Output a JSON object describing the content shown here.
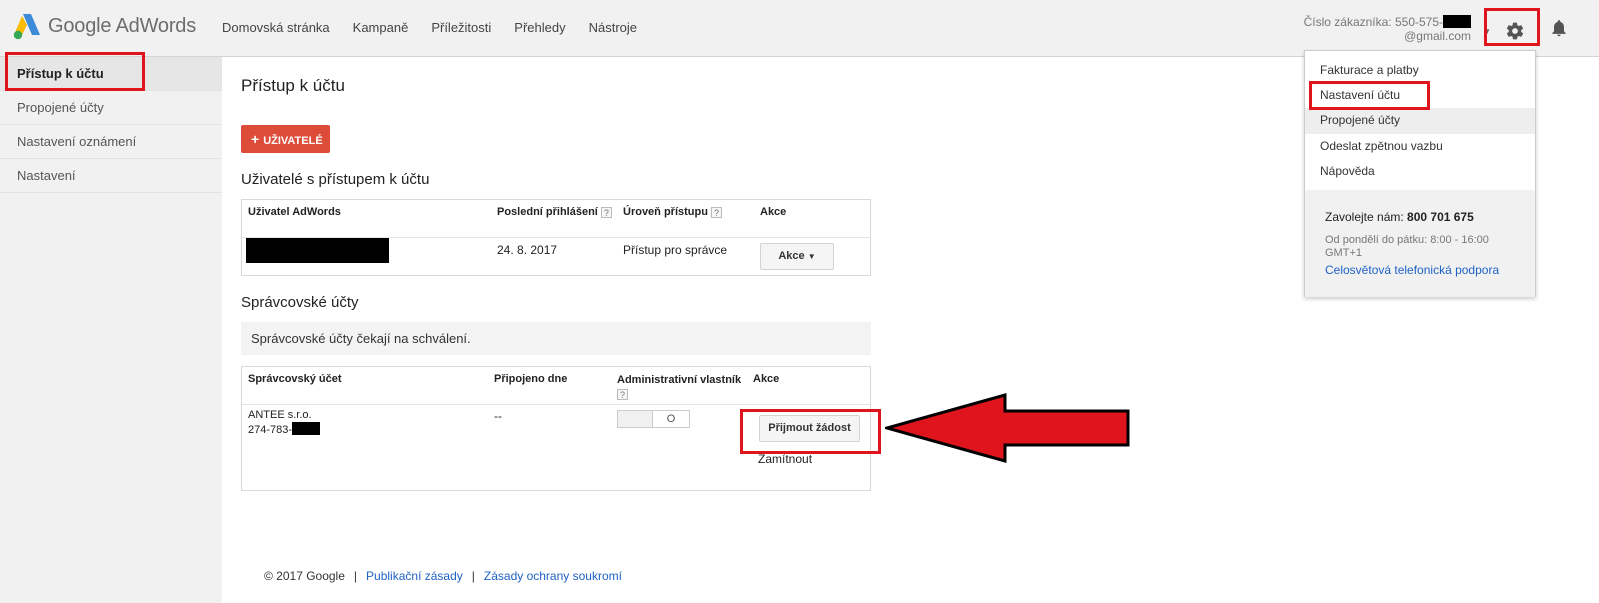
{
  "header": {
    "logo_text": "Google AdWords",
    "nav": [
      "Domovská stránka",
      "Kampaně",
      "Příležitosti",
      "Přehledy",
      "Nástroje"
    ],
    "customer_label": "Číslo zákazníka: 550-575-",
    "customer_email": "@gmail.com"
  },
  "sidebar": {
    "items": [
      {
        "label": "Přístup k účtu"
      },
      {
        "label": "Propojené účty"
      },
      {
        "label": "Nastavení oznámení"
      },
      {
        "label": "Nastavení"
      }
    ]
  },
  "main": {
    "title": "Přístup k účtu",
    "add_button": "UŽIVATELÉ",
    "users_section": "Uživatelé s přístupem k účtu",
    "users_table": {
      "headers": [
        "Uživatel AdWords",
        "Poslední přihlášení",
        "Úroveň přístupu",
        "Akce"
      ],
      "row": {
        "last_login": "24. 8. 2017",
        "access_level": "Přístup pro správce",
        "action": "Akce"
      }
    },
    "managers_section": "Správcovské účty",
    "pending_note": "Správcovské účty čekají na schválení.",
    "managers_table": {
      "headers": [
        "Správcovský účet",
        "Připojeno dne",
        "Administrativní vlastník",
        "Akce"
      ],
      "row": {
        "name": "ANTEE s.r.o.",
        "id": "274-783-",
        "connected": "--",
        "toggle_state": "O",
        "accept": "Přijmout žádost",
        "reject": "Zamítnout"
      }
    }
  },
  "dropdown": {
    "items": [
      "Fakturace a platby",
      "Nastavení účtu",
      "Propojené účty",
      "Odeslat zpětnou vazbu",
      "Nápověda"
    ],
    "call_label": "Zavolejte nám:",
    "call_number": "800 701 675",
    "hours": "Od pondělí do pátku: 8:00 - 16:00 GMT+1",
    "support_link": "Celosvětová telefonická podpora"
  },
  "footer": {
    "copyright": "© 2017 Google",
    "links": [
      "Publikační zásady",
      "Zásady ochrany soukromí"
    ]
  },
  "colors": {
    "annotation_red": "#e0141d",
    "add_button": "#dd4b39",
    "link": "#1e62c5"
  }
}
